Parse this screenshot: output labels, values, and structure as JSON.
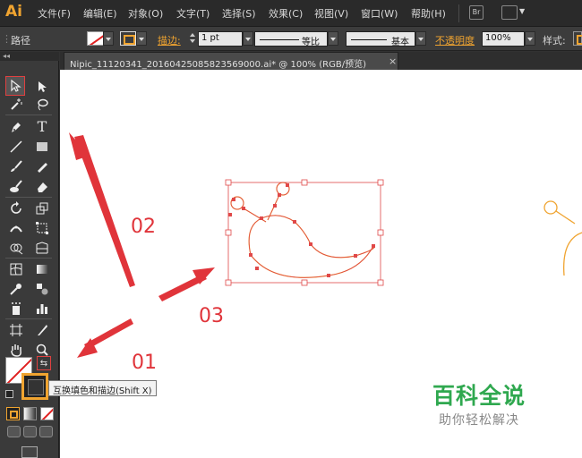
{
  "app": {
    "logo": "Ai",
    "menus": [
      "文件(F)",
      "编辑(E)",
      "对象(O)",
      "文字(T)",
      "选择(S)",
      "效果(C)",
      "视图(V)",
      "窗口(W)",
      "帮助(H)"
    ],
    "bridge_icon": "Br"
  },
  "control_bar": {
    "selection_label": "路径",
    "stroke_label": "描边:",
    "stroke_weight": "1 pt",
    "profile_label": "等比",
    "brush_label": "基本",
    "opacity_label": "不透明度",
    "opacity_value": "100%",
    "style_label": "样式:"
  },
  "document": {
    "tab_title": "Nipic_11120341_20160425085823569000.ai* @ 100% (RGB/预览)",
    "close_glyph": "×"
  },
  "toolbox": {
    "collapse_glyph": "◂◂",
    "swap_glyph": "⇆"
  },
  "tooltip": {
    "text": "互换填色和描边(Shift X)"
  },
  "annotations": {
    "step_01": "01",
    "step_02": "02",
    "step_03": "03",
    "arrow_color": "#e0343a"
  },
  "watermark": {
    "title": "百科全说",
    "subtitle": "助你轻松解决",
    "color": "#2fa84f"
  },
  "colors": {
    "accent": "#f0a430",
    "selection": "#e04040",
    "path_stroke": "#f0a430"
  }
}
